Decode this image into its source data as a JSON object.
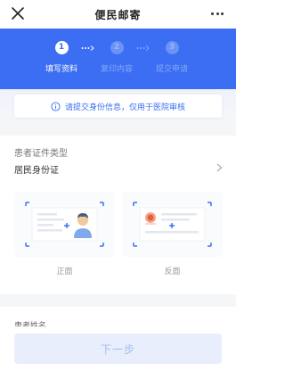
{
  "header": {
    "title": "便民邮寄",
    "close_icon": "close-icon",
    "more_icon": "more-icon"
  },
  "steps": [
    {
      "number": "1",
      "label": "填写资料",
      "state": "active"
    },
    {
      "number": "2",
      "label": "复印内容",
      "state": "inactive"
    },
    {
      "number": "3",
      "label": "提交申请",
      "state": "inactive"
    }
  ],
  "notice": {
    "icon": "info-icon",
    "text": "请提交身份信息，仅用于医院审核"
  },
  "id_type": {
    "label": "患者证件类型",
    "value": "居民身份证"
  },
  "upload": {
    "front_caption": "正面",
    "back_caption": "反面"
  },
  "peek_label": "患者姓名",
  "footer": {
    "next_label": "下一步"
  },
  "colors": {
    "primary": "#3b6ef2",
    "disabled_button": "#e8eefb",
    "background_gray": "#f5f6f8"
  }
}
